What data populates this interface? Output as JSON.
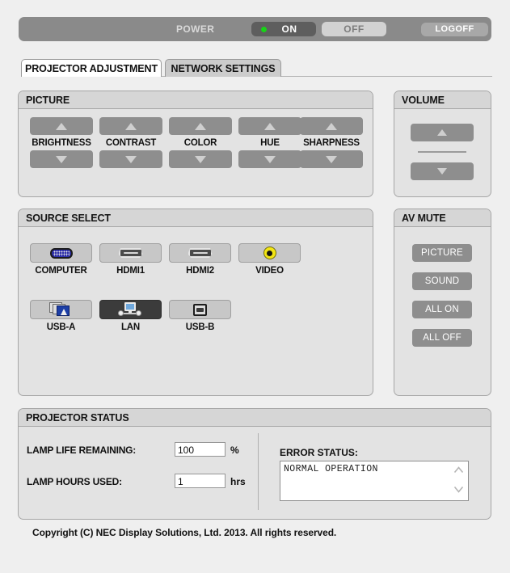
{
  "power_bar": {
    "label": "POWER",
    "on_label": "ON",
    "off_label": "OFF",
    "logoff_label": "LOGOFF",
    "state": "ON",
    "led_color": "#16d316",
    "bar_color": "#8a8a8a"
  },
  "tabs": [
    {
      "label": "PROJECTOR ADJUSTMENT",
      "active": true
    },
    {
      "label": "NETWORK SETTINGS",
      "active": false
    }
  ],
  "picture": {
    "title": "PICTURE",
    "controls": [
      {
        "label": "BRIGHTNESS",
        "up": "up-arrow-icon",
        "down": "down-arrow-icon"
      },
      {
        "label": "CONTRAST",
        "up": "up-arrow-icon",
        "down": "down-arrow-icon"
      },
      {
        "label": "COLOR",
        "up": "up-arrow-icon",
        "down": "down-arrow-icon"
      },
      {
        "label": "HUE",
        "up": "up-arrow-icon",
        "down": "down-arrow-icon"
      },
      {
        "label": "SHARPNESS",
        "up": "up-arrow-icon",
        "down": "down-arrow-icon"
      }
    ]
  },
  "volume": {
    "title": "VOLUME",
    "up_icon": "up-arrow-icon",
    "down_icon": "down-arrow-icon"
  },
  "source_select": {
    "title": "SOURCE SELECT",
    "selected": "LAN",
    "sources": [
      {
        "label": "COMPUTER",
        "icon": "vga-connector-icon"
      },
      {
        "label": "HDMI1",
        "icon": "hdmi-connector-icon"
      },
      {
        "label": "HDMI2",
        "icon": "hdmi-connector-icon"
      },
      {
        "label": "VIDEO",
        "icon": "rca-video-jack-icon"
      },
      {
        "label": "USB-A",
        "icon": "usb-a-slides-icon"
      },
      {
        "label": "LAN",
        "icon": "lan-network-icon"
      },
      {
        "label": "USB-B",
        "icon": "usb-b-connector-icon"
      }
    ]
  },
  "av_mute": {
    "title": "AV MUTE",
    "buttons": [
      {
        "label": "PICTURE"
      },
      {
        "label": "SOUND"
      },
      {
        "label": "ALL ON"
      },
      {
        "label": "ALL OFF"
      }
    ]
  },
  "projector_status": {
    "title": "PROJECTOR STATUS",
    "lamp_life_label": "LAMP LIFE REMAINING:",
    "lamp_life_value": "100",
    "lamp_life_unit": "%",
    "lamp_hours_label": "LAMP HOURS USED:",
    "lamp_hours_value": "1",
    "lamp_hours_unit": "hrs",
    "error_status_label": "ERROR STATUS:",
    "error_status_value": "NORMAL OPERATION"
  },
  "footer": {
    "copyright": "Copyright (C) NEC Display Solutions, Ltd. 2013. All rights reserved."
  }
}
